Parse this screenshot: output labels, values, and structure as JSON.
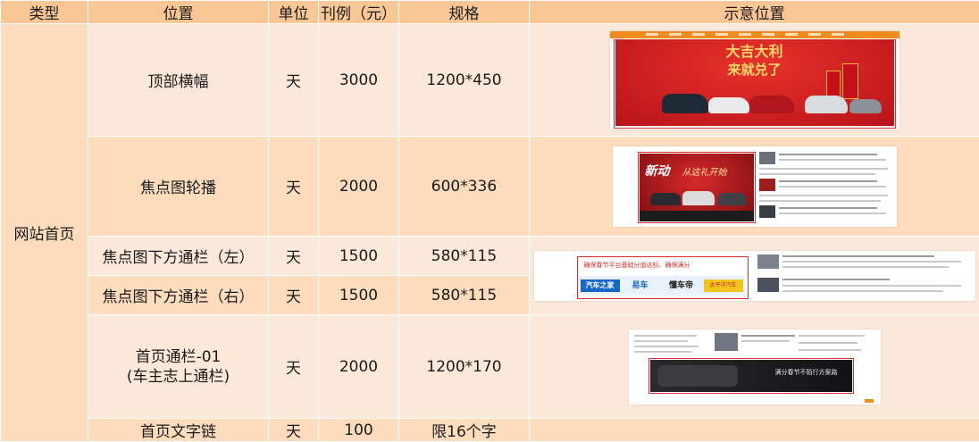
{
  "headers": [
    "类型",
    "位置",
    "单位",
    "刊例（元）",
    "规格",
    "示意位置"
  ],
  "category": "网站首页",
  "rows": [
    {
      "position": "顶部横幅",
      "unit": "天",
      "price": "3000",
      "spec": "1200*450"
    },
    {
      "position": "焦点图轮播",
      "unit": "天",
      "price": "2000",
      "spec": "600*336"
    },
    {
      "position": "焦点图下方通栏（左）",
      "unit": "天",
      "price": "1500",
      "spec": "580*115"
    },
    {
      "position": "焦点图下方通栏（右）",
      "unit": "天",
      "price": "1500",
      "spec": "580*115"
    },
    {
      "position_line1": "首页通栏-01",
      "position_line2": "(车主志上通栏)",
      "unit": "天",
      "price": "2000",
      "spec": "1200*170"
    },
    {
      "position": "首页文字链",
      "unit": "天",
      "price": "100",
      "spec": "限16个字"
    }
  ],
  "thumbnails": {
    "banner": {
      "headline_1": "大吉大利",
      "headline_2": "来就兑了"
    },
    "focus": {
      "slogan_1": "新动",
      "slogan_2": "从这礼开始"
    },
    "strip": {
      "tagline": "确保春节平台基础分值达标、确保满分",
      "logos": [
        "汽车之家",
        "易车",
        "懂车帝",
        "太平洋汽车"
      ]
    },
    "through": {
      "caption": "满分春节不陌行方案路"
    }
  },
  "colors": {
    "header_bg": "#f9c796",
    "row_light": "#fce8d8",
    "row_dark": "#fcdcbd",
    "highlight_red": "#d8302a"
  }
}
